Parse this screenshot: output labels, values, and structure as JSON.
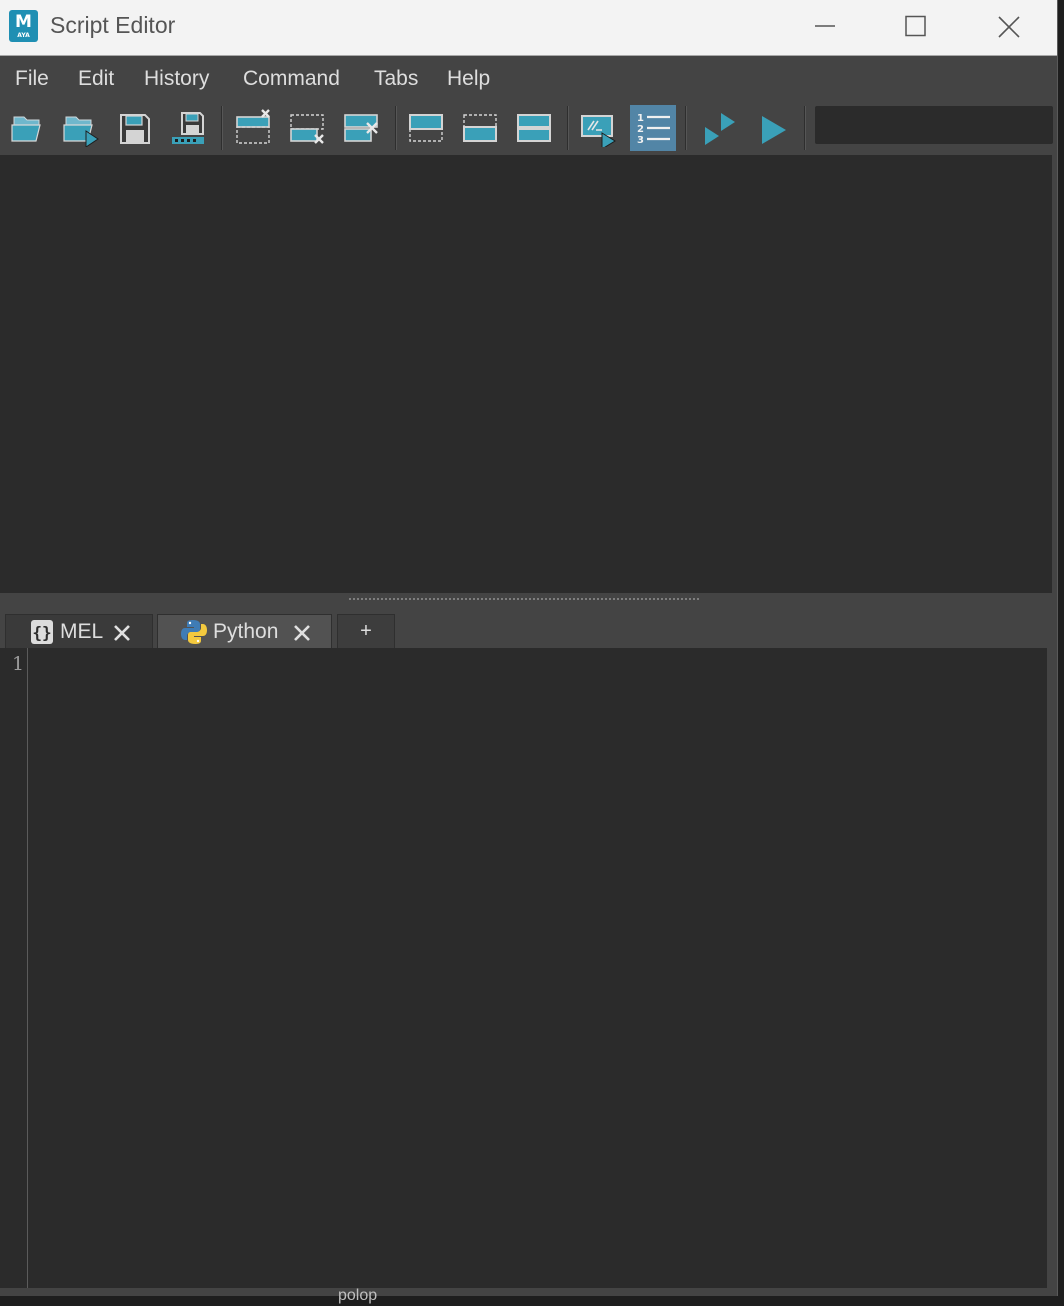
{
  "window": {
    "title": "Script Editor",
    "logo": {
      "letter": "M",
      "sub": "AYA"
    },
    "controls": [
      "minimize-icon",
      "maximize-icon",
      "close-icon"
    ]
  },
  "menu": {
    "items": [
      {
        "label": "File"
      },
      {
        "label": "Edit"
      },
      {
        "label": "History"
      },
      {
        "label": "Command"
      },
      {
        "label": "Tabs"
      },
      {
        "label": "Help"
      }
    ]
  },
  "toolbar": {
    "buttons": [
      {
        "icon": "open-script-icon"
      },
      {
        "icon": "source-script-icon"
      },
      {
        "icon": "save-script-icon"
      },
      {
        "icon": "save-script-to-shelf-icon"
      },
      {
        "icon": "clear-history-icon"
      },
      {
        "icon": "clear-input-icon"
      },
      {
        "icon": "clear-all-icon"
      },
      {
        "icon": "show-history-only-icon"
      },
      {
        "icon": "show-input-only-icon"
      },
      {
        "icon": "show-both-icon"
      },
      {
        "icon": "echo-all-commands-icon"
      },
      {
        "icon": "show-line-numbers-icon",
        "active": true
      },
      {
        "icon": "execute-selected-icon"
      },
      {
        "icon": "execute-all-icon"
      }
    ],
    "search_value": ""
  },
  "tabs": {
    "items": [
      {
        "label": "MEL",
        "icon": "mel-braces-icon",
        "active": false
      },
      {
        "label": "Python",
        "icon": "python-logo-icon",
        "active": true
      }
    ],
    "add_label": "+"
  },
  "editor": {
    "line_numbers": [
      "1"
    ],
    "content": ""
  },
  "background": {
    "partial_text": "polop"
  },
  "colors": {
    "accent": "#3aa0b8",
    "active_toggle": "#5285a6",
    "panel": "#2b2b2b",
    "chrome": "#444444"
  }
}
